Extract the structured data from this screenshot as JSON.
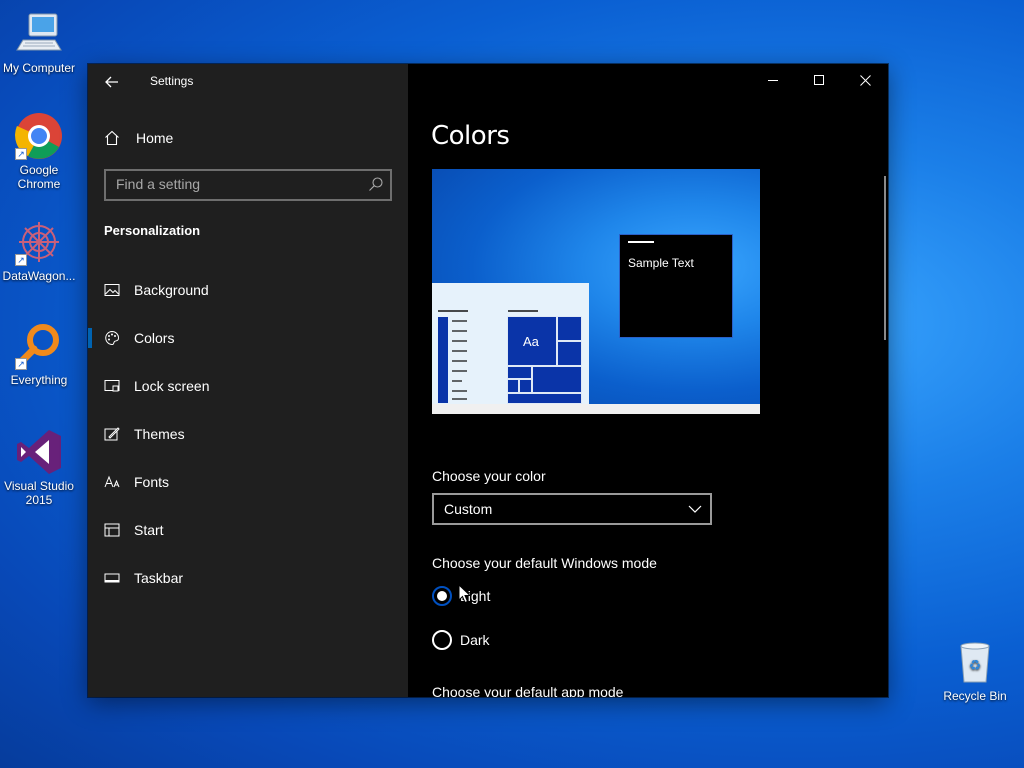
{
  "desktop": {
    "icons": [
      {
        "label": "My Computer",
        "icon": "computer-icon"
      },
      {
        "label": "Google Chrome",
        "icon": "chrome-icon"
      },
      {
        "label": "DataWagon...",
        "icon": "datawagon-icon"
      },
      {
        "label": "Everything",
        "icon": "everything-search-icon"
      },
      {
        "label": "Visual Studio 2015",
        "icon": "visual-studio-icon"
      },
      {
        "label": "Recycle Bin",
        "icon": "recycle-bin-icon"
      }
    ]
  },
  "window": {
    "title": "Settings",
    "controls": {
      "minimize": "minimize-icon",
      "maximize": "maximize-icon",
      "close": "close-icon"
    }
  },
  "sidebar": {
    "home_label": "Home",
    "search_placeholder": "Find a setting",
    "section_heading": "Personalization",
    "items": [
      {
        "label": "Background",
        "icon": "picture-icon"
      },
      {
        "label": "Colors",
        "icon": "palette-icon",
        "active": true
      },
      {
        "label": "Lock screen",
        "icon": "lock-screen-icon"
      },
      {
        "label": "Themes",
        "icon": "themes-icon"
      },
      {
        "label": "Fonts",
        "icon": "fonts-icon"
      },
      {
        "label": "Start",
        "icon": "start-icon"
      },
      {
        "label": "Taskbar",
        "icon": "taskbar-icon"
      }
    ]
  },
  "content": {
    "page_title": "Colors",
    "preview": {
      "sample_text": "Sample Text",
      "tile_text": "Aa"
    },
    "choose_color_label": "Choose your color",
    "choose_color_value": "Custom",
    "windows_mode_label": "Choose your default Windows mode",
    "windows_mode_options": [
      {
        "label": "Light",
        "checked": true
      },
      {
        "label": "Dark",
        "checked": false
      }
    ],
    "app_mode_label": "Choose your default app mode"
  },
  "colors": {
    "accent": "#0063b1",
    "sidebar_bg": "#1f1f1f",
    "content_bg": "#000000"
  }
}
